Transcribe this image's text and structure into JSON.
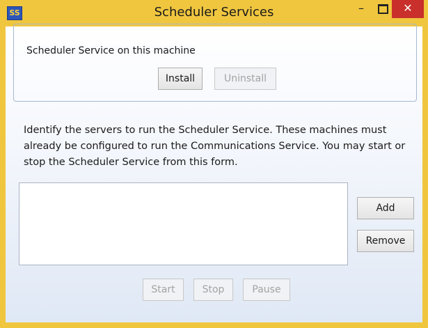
{
  "window": {
    "title": "Scheduler Services",
    "icon_text": "SS",
    "controls": {
      "minimize": "–",
      "close": "✕"
    }
  },
  "group": {
    "label": "Scheduler Service on this machine",
    "install_label": "Install",
    "uninstall_label": "Uninstall"
  },
  "description": "Identify the servers to run the Scheduler Service. These machines must already be configured to run the Communications Service. You may start or stop the Scheduler Service from this form.",
  "servers": {
    "items": [],
    "add_label": "Add",
    "remove_label": "Remove"
  },
  "service_controls": {
    "start_label": "Start",
    "stop_label": "Stop",
    "pause_label": "Pause"
  },
  "colors": {
    "frame": "#f0c63f",
    "close_button": "#c9302b"
  }
}
